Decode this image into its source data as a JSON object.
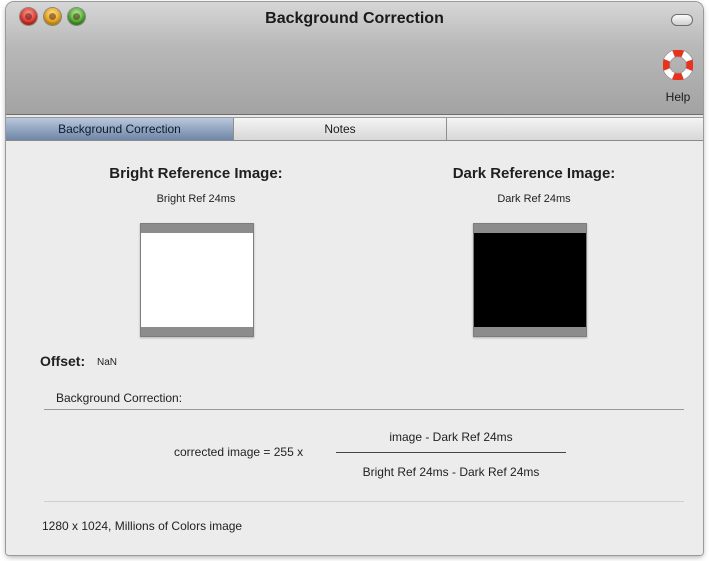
{
  "window": {
    "title": "Background Correction",
    "help_label": "Help"
  },
  "tabs": [
    {
      "label": "Background Correction",
      "active": true
    },
    {
      "label": "Notes",
      "active": false
    },
    {
      "label": "",
      "active": false
    }
  ],
  "bright": {
    "heading": "Bright Reference Image:",
    "name": "Bright Ref 24ms"
  },
  "dark": {
    "heading": "Dark Reference Image:",
    "name": "Dark Ref 24ms"
  },
  "offset": {
    "label": "Offset:",
    "value": "NaN"
  },
  "correction": {
    "section_label": "Background Correction:",
    "lhs": "corrected image = 255 x",
    "numerator": "image - Dark Ref 24ms",
    "denominator": "Bright Ref 24ms - Dark Ref 24ms"
  },
  "status": {
    "text": "1280 x 1024, Millions of Colors image"
  },
  "colors": {
    "active_tab": "#6f86a6",
    "close": "#d9261c",
    "minimize": "#e29a0a",
    "zoom": "#3b9a1d",
    "help_ring": "#e8321e"
  }
}
